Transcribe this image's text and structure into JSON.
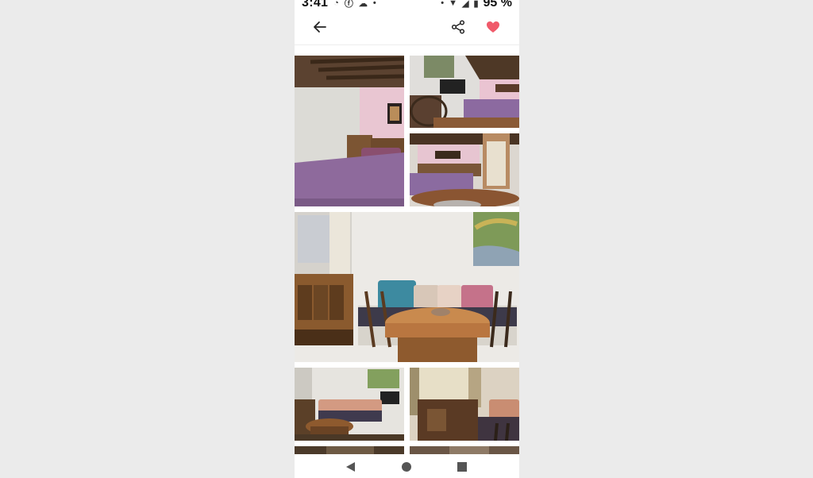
{
  "status_bar": {
    "time": "3:41",
    "battery": "95 %",
    "notification_icons": [
      "whatsapp-icon",
      "facebook-icon",
      "messenger-icon",
      "dot-icon"
    ],
    "system_icons": [
      "dot-icon",
      "wifi-icon",
      "signal-icon",
      "battery-icon"
    ]
  },
  "toolbar": {
    "icons": [
      "back-arrow-icon",
      "share-icon",
      "heart-icon"
    ],
    "favorite_color": "#f05a6a"
  },
  "gallery": {
    "photos": [
      "bedroom-photo",
      "bedroom-tv-photo",
      "bedroom-door-photo",
      "dining-living-room-photo",
      "living-room-photo",
      "sitting-area-photo",
      "partial-photo-bottom-left",
      "partial-photo-bottom-right"
    ]
  },
  "nav_bar": {
    "icons": [
      "nav-back-icon",
      "nav-home-icon",
      "nav-recents-icon"
    ]
  }
}
